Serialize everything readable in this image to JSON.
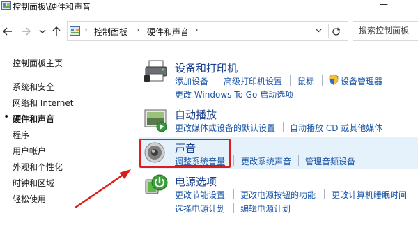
{
  "window": {
    "title": "控制面板\\硬件和声音",
    "minimize_glyph": "—"
  },
  "address": {
    "crumbs": [
      "控制面板",
      "硬件和声音"
    ],
    "search_placeholder": "搜索控制面板"
  },
  "leftnav": {
    "items": [
      "控制面板主页",
      "系统和安全",
      "网络和 Internet",
      "硬件和声音",
      "程序",
      "用户帐户",
      "外观和个性化",
      "时钟和区域",
      "轻松使用"
    ],
    "active_index": 3
  },
  "categories": {
    "devices": {
      "title": "设备和打印机",
      "links_row1": [
        "添加设备",
        "高级打印机设置",
        "鼠标",
        "设备管理器"
      ],
      "links_row2": [
        "更改 Windows To Go 启动选项"
      ]
    },
    "autoplay": {
      "title": "自动播放",
      "links_row1": [
        "更改媒体或设备的默认设置",
        "自动播放 CD 或其他媒体"
      ]
    },
    "sound": {
      "title": "声音",
      "links_row1": [
        "调整系统音量",
        "更改系统声音",
        "管理音频设备"
      ]
    },
    "power": {
      "title": "电源选项",
      "links_row1": [
        "更改节能设置",
        "更改电源按钮的功能",
        "更改计算机睡眠时间"
      ],
      "links_row2": [
        "选择电源计划",
        "编辑电源计划"
      ]
    }
  },
  "colors": {
    "category_title": "#1a3f8c",
    "link": "#1d57a8",
    "highlight_bg": "#e5f1fb",
    "annotation_red": "#e01b1b"
  },
  "icons": {
    "back": "left-arrow-icon",
    "forward": "right-arrow-icon",
    "recent": "chevron-down-icon",
    "up": "up-arrow-icon",
    "refresh": "refresh-icon",
    "shield": "uac-shield-icon"
  }
}
